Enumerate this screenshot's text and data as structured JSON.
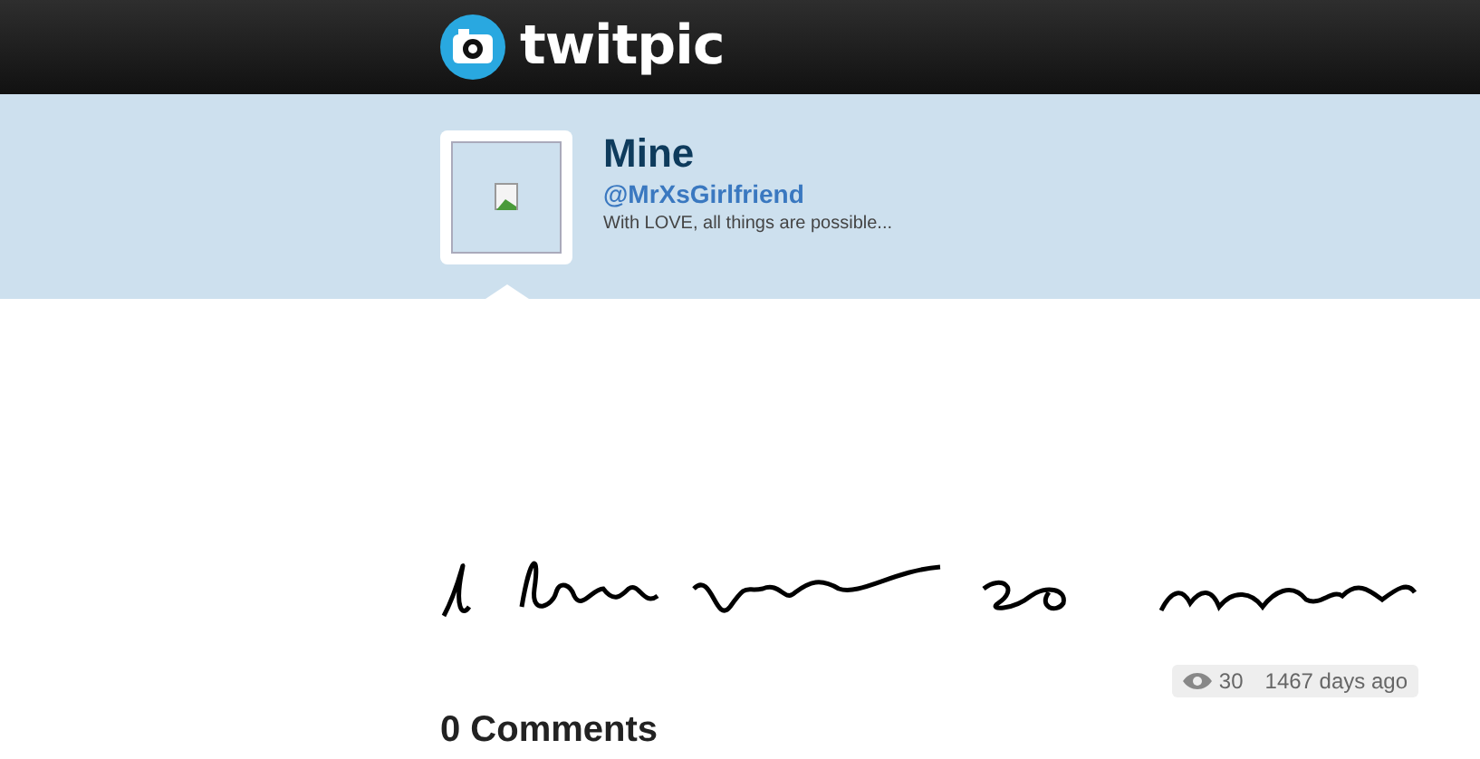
{
  "header": {
    "logo_text": "twitpic"
  },
  "profile": {
    "name": "Mine",
    "handle": "@MrXsGirlfriend",
    "bio": "With LOVE, all things are possible..."
  },
  "stats": {
    "views": "30",
    "age": "1467 days ago"
  },
  "comments": {
    "title": "0 Comments"
  }
}
